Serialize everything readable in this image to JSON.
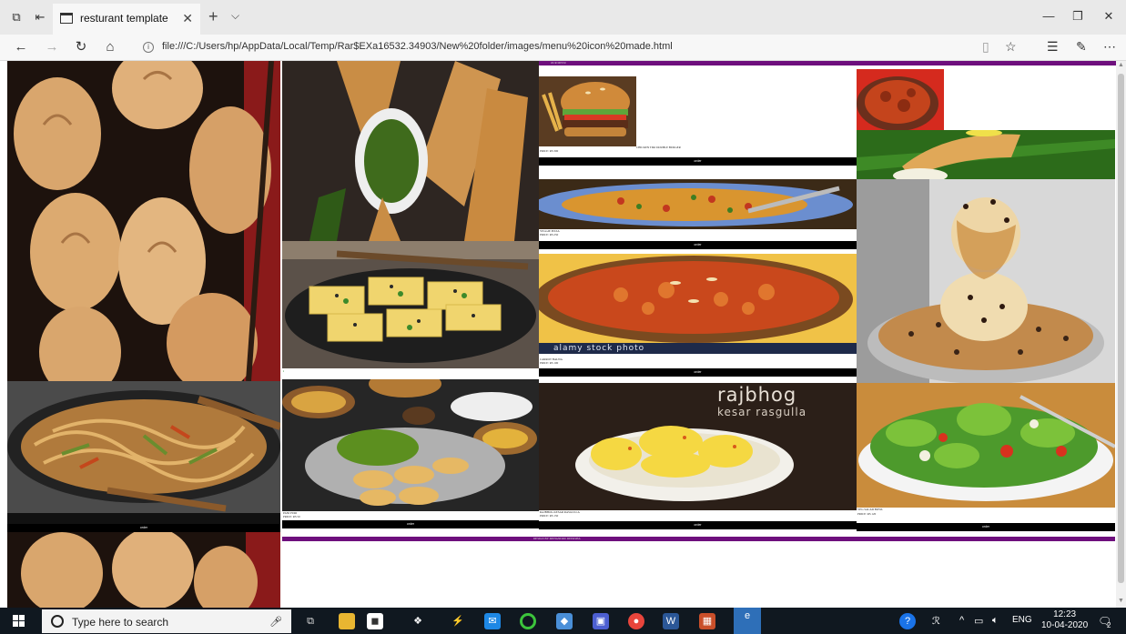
{
  "browser": {
    "tab_title": "resturant template",
    "new_tab_symbol": "+",
    "url": "file:///C:/Users/hp/AppData/Local/Temp/Rar$EXa16532.34903/New%20folder/images/menu%20icon%20made.html",
    "info_symbol": "i",
    "icons": [
      "tab-actions-icon",
      "set-aside-tabs-icon",
      "tab-page-icon",
      "close-icon",
      "new-tab-icon",
      "tab-menu-icon",
      "minimize-icon",
      "restore-icon",
      "window-close-icon",
      "back-icon",
      "forward-icon",
      "refresh-icon",
      "home-icon",
      "reading-view-icon",
      "favorite-star-icon",
      "favorites-icon",
      "pen-icon",
      "more-icon"
    ]
  },
  "page": {
    "colors": {
      "accent_bar": "#6e0f7d",
      "order_bar": "#000000"
    },
    "header_text": "OUR MENU",
    "footer_text": "DESIGN BY MEHANDRU DEEKSHA",
    "order_label": "order",
    "items": [
      {
        "image": "burger",
        "caption": "PRICE: RS 300",
        "caption2": "CHICKEN TIKI DOUBLE BURGER"
      },
      {
        "image": "pizza",
        "caption": "VEGGIE PIZZA",
        "caption2": "PRICE: RS 250"
      },
      {
        "image": "halwa",
        "caption": "CARROT HALWA",
        "caption2": "PRICE: RS 100"
      },
      {
        "image": "rasgulla",
        "caption": "RAJBHOG KESAR RASGULLA",
        "caption2": "PRICE: RS 150"
      },
      {
        "image": "pani-puri",
        "caption": "PANI PURI",
        "caption2": "PRICE: RS 50"
      },
      {
        "image": "salad",
        "caption": "VEG SALAD BOWL",
        "caption2": "PRICE: RS 120"
      }
    ],
    "watermark": "alamy stock photo",
    "rasgulla_title": "rajbhog",
    "rasgulla_subtitle": "kesar rasgulla"
  },
  "taskbar": {
    "search_placeholder": "Type here to search",
    "language": "ENG",
    "time": "12:23",
    "date": "10-04-2020",
    "notification_count": "2",
    "icons": [
      "windows-start-icon",
      "cortana-icon",
      "microphone-icon",
      "task-view-icon",
      "file-explorer-icon",
      "store-icon",
      "dropbox-icon",
      "visual-studio-icon",
      "mail-icon",
      "spinner-app-icon",
      "app-icon",
      "media-icon",
      "chrome-icon",
      "word-icon",
      "tiles-app-icon",
      "edge-icon",
      "help-icon",
      "people-icon",
      "tray-chevron-icon",
      "battery-icon",
      "volume-icon",
      "notification-icon"
    ]
  }
}
